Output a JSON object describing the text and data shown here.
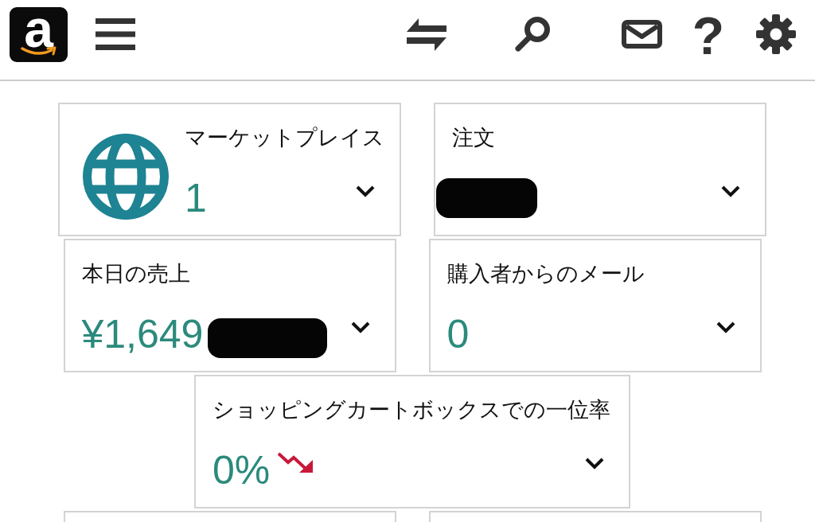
{
  "header": {
    "logo": {
      "letter": "a"
    },
    "help_button": {
      "label": "?"
    }
  },
  "cards": [
    {
      "kind": "marketplace",
      "title": "マーケットプレイス",
      "value": "1",
      "expanded": false
    },
    {
      "kind": "metric",
      "title": "注文",
      "redacted": true,
      "expanded": false
    },
    {
      "kind": "metric",
      "title": "本日の売上",
      "value": "¥1,649",
      "redacted": true,
      "expanded": false
    },
    {
      "kind": "metric",
      "title": "購入者からのメール",
      "value": "0",
      "expanded": false
    },
    {
      "kind": "metric",
      "title": "ショッピングカートボックスでの一位率",
      "value": "0%",
      "trend_down": true,
      "expanded": false
    }
  ]
}
